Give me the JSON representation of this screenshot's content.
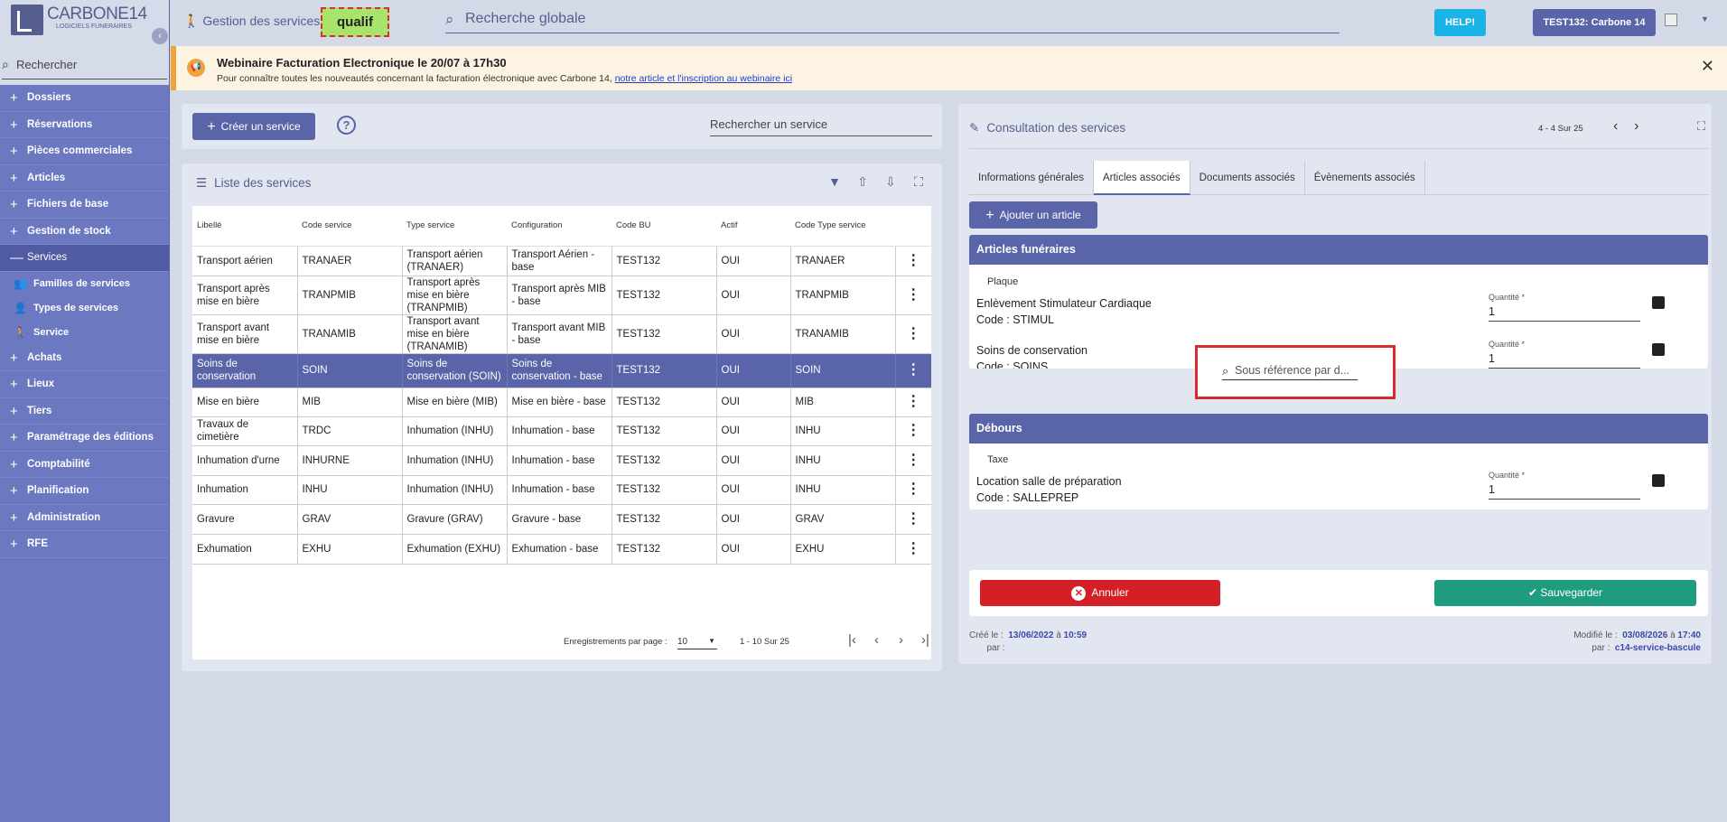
{
  "app": {
    "logo_name": "CARBONE14",
    "logo_sub": "LOGICIELS FUNERAIRES",
    "env_badge": "qualif"
  },
  "sidebar": {
    "search_placeholder": "Rechercher",
    "items": [
      {
        "label": "Dossiers"
      },
      {
        "label": "Réservations"
      },
      {
        "label": "Pièces commerciales"
      },
      {
        "label": "Articles"
      },
      {
        "label": "Fichiers de base"
      },
      {
        "label": "Gestion de stock"
      },
      {
        "label": "Services"
      },
      {
        "label": "Achats"
      },
      {
        "label": "Lieux"
      },
      {
        "label": "Tiers"
      },
      {
        "label": "Paramétrage des éditions"
      },
      {
        "label": "Comptabilité"
      },
      {
        "label": "Planification"
      },
      {
        "label": "Administration"
      },
      {
        "label": "RFE"
      }
    ],
    "sub_items": [
      {
        "label": "Familles de services",
        "icon": "group-icon"
      },
      {
        "label": "Types de services",
        "icon": "people-icon"
      },
      {
        "label": "Service",
        "icon": "person-walk-icon"
      }
    ]
  },
  "topbar": {
    "title": "Gestion des services",
    "search_placeholder": "Recherche globale",
    "help_label": "HELP!",
    "user_label": "TEST132: Carbone 14"
  },
  "banner": {
    "title": "Webinaire Facturation Electronique le 20/07 à 17h30",
    "text": "Pour connaître toutes les nouveautés concernant la facturation électronique avec Carbone 14,",
    "link": "notre article et l'inscription au webinaire ici"
  },
  "left": {
    "create_label": "Créer un service",
    "search_placeholder": "Rechercher un service",
    "list_title": "Liste des services",
    "columns": [
      "Libellé",
      "Code service",
      "Type service",
      "Configuration",
      "Code BU",
      "Actif",
      "Code Type service"
    ],
    "rows": [
      {
        "libelle": "Transport aérien",
        "code": "TRANAER",
        "type": "Transport aérien (TRANAER)",
        "config": "Transport Aérien - base",
        "bu": "TEST132",
        "actif": "OUI",
        "type_code": "TRANAER"
      },
      {
        "libelle": "Transport après mise en bière",
        "code": "TRANPMIB",
        "type": "Transport après mise en bière (TRANPMIB)",
        "config": "Transport après MIB - base",
        "bu": "TEST132",
        "actif": "OUI",
        "type_code": "TRANPMIB"
      },
      {
        "libelle": "Transport avant mise en bière",
        "code": "TRANAMIB",
        "type": "Transport avant mise en bière (TRANAMIB)",
        "config": "Transport avant MIB - base",
        "bu": "TEST132",
        "actif": "OUI",
        "type_code": "TRANAMIB"
      },
      {
        "libelle": "Soins de conservation",
        "code": "SOIN",
        "type": "Soins de conservation (SOIN)",
        "config": "Soins de conservation - base",
        "bu": "TEST132",
        "actif": "OUI",
        "type_code": "SOIN",
        "selected": true
      },
      {
        "libelle": "Mise en bière",
        "code": "MIB",
        "type": "Mise en bière (MIB)",
        "config": "Mise en bière - base",
        "bu": "TEST132",
        "actif": "OUI",
        "type_code": "MIB"
      },
      {
        "libelle": "Travaux de cimetière",
        "code": "TRDC",
        "type": "Inhumation (INHU)",
        "config": "Inhumation - base",
        "bu": "TEST132",
        "actif": "OUI",
        "type_code": "INHU"
      },
      {
        "libelle": "Inhumation d'urne",
        "code": "INHURNE",
        "type": "Inhumation (INHU)",
        "config": "Inhumation - base",
        "bu": "TEST132",
        "actif": "OUI",
        "type_code": "INHU"
      },
      {
        "libelle": "Inhumation",
        "code": "INHU",
        "type": "Inhumation (INHU)",
        "config": "Inhumation - base",
        "bu": "TEST132",
        "actif": "OUI",
        "type_code": "INHU"
      },
      {
        "libelle": "Gravure",
        "code": "GRAV",
        "type": "Gravure (GRAV)",
        "config": "Gravure - base",
        "bu": "TEST132",
        "actif": "OUI",
        "type_code": "GRAV"
      },
      {
        "libelle": "Exhumation",
        "code": "EXHU",
        "type": "Exhumation (EXHU)",
        "config": "Exhumation - base",
        "bu": "TEST132",
        "actif": "OUI",
        "type_code": "EXHU"
      }
    ],
    "pager": {
      "rpp_label": "Enregistrements par page :",
      "rpp_value": "10",
      "range": "1 - 10 Sur 25"
    }
  },
  "right": {
    "title": "Consultation des services",
    "count": "4 - 4 Sur 25",
    "tabs": [
      "Informations générales",
      "Articles associés",
      "Documents associés",
      "Évènements associés"
    ],
    "add_label": "Ajouter un article",
    "funeraires": {
      "title": "Articles funéraires",
      "subheader": "Plaque",
      "items": [
        {
          "name": "Enlèvement Stimulateur Cardiaque",
          "code": "Code : STIMUL",
          "qty_label": "Quantité *",
          "qty": "1"
        },
        {
          "name": "Soins de conservation",
          "code": "Code : SOINS",
          "qty_label": "Quantité *",
          "qty": "1"
        }
      ]
    },
    "sous_ref_placeholder": "Sous référence par d...",
    "debours": {
      "title": "Débours",
      "subheader": "Taxe",
      "items": [
        {
          "name": "Location salle de préparation",
          "code": "Code : SALLEPREP",
          "qty_label": "Quantité *",
          "qty": "1"
        }
      ]
    },
    "cancel_label": "Annuler",
    "save_label": "Sauvegarder",
    "meta": {
      "created_label": "Créé le :",
      "created_date": "13/06/2022",
      "created_at": "à",
      "created_time": "10:59",
      "created_by_label": "par :",
      "modified_label": "Modifié le :",
      "modified_date": "03/08/2026",
      "modified_at": "à",
      "modified_time": "17:40",
      "modified_by_label": "par :",
      "modified_by": "c14-service-bascule"
    }
  },
  "colors": {
    "accent": "#5a64a8",
    "sidebar": "#6c78c0",
    "cancel": "#d51f26",
    "save": "#1f9c80",
    "help": "#1ab3e8",
    "badge": "#a8e36b"
  }
}
